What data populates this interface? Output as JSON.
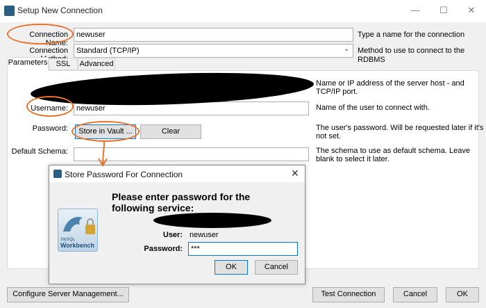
{
  "window": {
    "title": "Setup New Connection",
    "minimize_icon": "minimize-icon",
    "maximize_icon": "maximize-icon",
    "close_icon": "close-icon"
  },
  "form": {
    "connection_name_label": "Connection Name:",
    "connection_name_value": "newuser",
    "connection_name_hint": "Type a name for the connection",
    "connection_method_label": "Connection Method:",
    "connection_method_value": "Standard (TCP/IP)",
    "connection_method_hint": "Method to use to connect to the RDBMS"
  },
  "tabs": [
    "Parameters",
    "SSL",
    "Advanced"
  ],
  "parameters": {
    "hostname_hint_line1": "Name or IP address of the server host - and",
    "hostname_hint_line2": "TCP/IP port.",
    "username_label": "Username:",
    "username_value": "newuser",
    "username_hint": "Name of the user to connect with.",
    "password_label": "Password:",
    "store_in_vault_label": "Store in Vault ...",
    "clear_label": "Clear",
    "password_hint_line1": "The user's password. Will be requested later if it's",
    "password_hint_line2": "not set.",
    "default_schema_label": "Default Schema:",
    "default_schema_value": "",
    "default_schema_hint_line1": "The schema to use as default schema. Leave",
    "default_schema_hint_line2": "blank to select it later."
  },
  "footer": {
    "configure_label": "Configure Server Management...",
    "test_label": "Test Connection",
    "cancel_label": "Cancel",
    "ok_label": "OK"
  },
  "dialog": {
    "title": "Store Password For Connection",
    "message_line1": "Please enter password for the",
    "message_line2": "following service:",
    "user_label": "User:",
    "user_value": "newuser",
    "password_label": "Password:",
    "password_value": "***",
    "ok_label": "OK",
    "cancel_label": "Cancel",
    "logo_text_small": "MySQL",
    "logo_text": "Workbench"
  },
  "colors": {
    "annotation": "#e8722a",
    "accent": "#0078d7",
    "redaction": "#000000"
  }
}
